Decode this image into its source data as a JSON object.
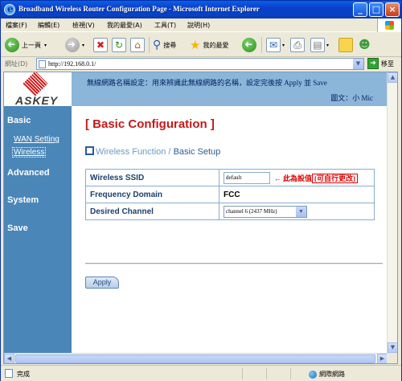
{
  "window": {
    "title": "Broadband Wireless Router Configuration Page - Microsoft Internet Explorer",
    "buttons": {
      "minimize": "_",
      "maximize": "□",
      "close": "×"
    }
  },
  "menu": [
    "檔案(F)",
    "編輯(E)",
    "檢視(V)",
    "我的最愛(A)",
    "工具(T)",
    "說明(H)"
  ],
  "toolbar": {
    "back": "上一頁",
    "search": "搜尋",
    "favorites": "我的最愛"
  },
  "address": {
    "label": "網址(D)",
    "url": "http://192.168.0.1/",
    "go": "移至"
  },
  "banner": {
    "logo": "ASKEY",
    "note": "無線網路名稱設定：用來辨識此無線網路的名稱，設定完後按 Apply 並 Save",
    "credit": "圖文：小 Mic"
  },
  "sidebar": {
    "basic": "Basic",
    "wan": "WAN Setting",
    "wireless": "Wireless",
    "advanced": "Advanced",
    "system": "System",
    "save": "Save"
  },
  "content": {
    "heading": "[ Basic Configuration ]",
    "subhead_a": "Wireless Function / ",
    "subhead_b": "Basic Setup",
    "rows": [
      {
        "label": "Wireless SSID",
        "value": "default"
      },
      {
        "label": "Frequency Domain",
        "value": "FCC"
      },
      {
        "label": "Desired Channel",
        "value": "channel 6 (2437 MHz)"
      }
    ],
    "ssid_note_prefix": "← 此為設值",
    "ssid_note_box": "(可自行更改)",
    "apply": "Apply"
  },
  "status": {
    "text": "完成",
    "zone": "網際網路"
  }
}
